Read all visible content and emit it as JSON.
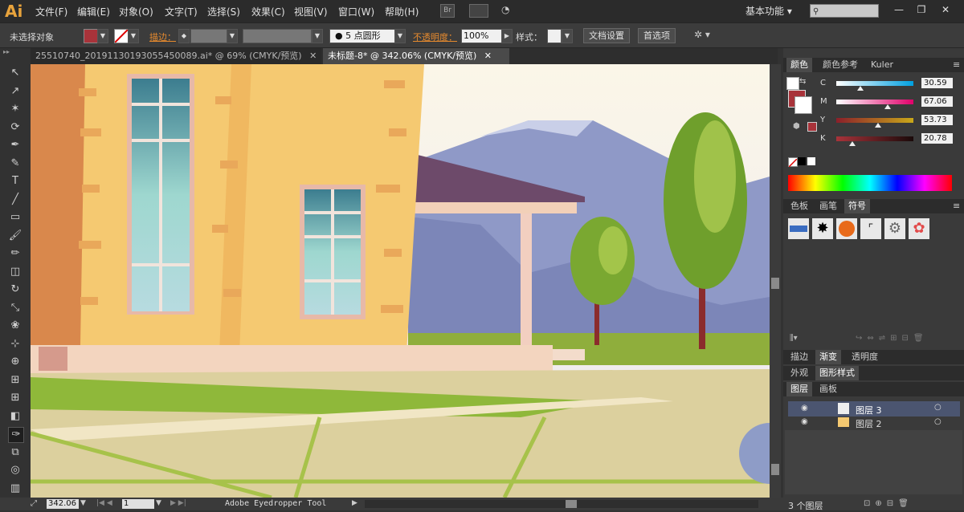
{
  "app": {
    "logo": "Ai"
  },
  "menu": [
    "文件(F)",
    "编辑(E)",
    "对象(O)",
    "文字(T)",
    "选择(S)",
    "效果(C)",
    "视图(V)",
    "窗口(W)",
    "帮助(H)"
  ],
  "toolbar_icons": {
    "bridge": "Br"
  },
  "workspace": {
    "label": "基本功能"
  },
  "window_controls": {
    "minimize": "—",
    "restore": "❐",
    "close": "✕"
  },
  "control_bar": {
    "selection": "未选择对象",
    "fill_color": "#a8333a",
    "stroke_label": "描边：",
    "brush": "5 点圆形",
    "opacity_label": "不透明度：",
    "opacity_value": "100%",
    "style_label": "样式：",
    "doc_settings": "文档设置",
    "preferences": "首选项"
  },
  "tabs": [
    {
      "title": "25510740_2019113019305545008​9.ai* @ 69% (CMYK/预览)",
      "close": "✕"
    },
    {
      "title": "未标题-8* @ 342.06% (CMYK/预览)",
      "close": "✕"
    }
  ],
  "tools": [
    "selection-tool",
    "direct-selection-tool",
    "magic-wand-tool",
    "lasso-tool",
    "pen-tool",
    "curvature-tool",
    "type-tool",
    "line-tool",
    "rectangle-tool",
    "paintbrush-tool",
    "pencil-tool",
    "eraser-tool",
    "rotate-tool",
    "scale-tool",
    "warp-tool",
    "free-transform-tool",
    "shape-builder-tool",
    "perspective-grid-tool",
    "mesh-tool",
    "gradient-tool",
    "eyedropper-tool",
    "blend-tool",
    "symbol-sprayer-tool",
    "column-graph-tool"
  ],
  "color_panel": {
    "tabs": [
      "颜色",
      "颜色参考",
      "Kuler"
    ],
    "channels": [
      {
        "label": "C",
        "value": "30.59",
        "fraction": 0.31
      },
      {
        "label": "M",
        "value": "67.06",
        "fraction": 0.67
      },
      {
        "label": "Y",
        "value": "53.73",
        "fraction": 0.54
      },
      {
        "label": "K",
        "value": "20.78",
        "fraction": 0.21
      }
    ],
    "current_color": "#a8333a"
  },
  "symbols_panel": {
    "tabs": [
      "色板",
      "画笔",
      "符号"
    ]
  },
  "stroke_panel": {
    "tabs": [
      "描边",
      "渐变",
      "透明度"
    ]
  },
  "appearance_panel": {
    "tabs": [
      "外观",
      "图形样式"
    ]
  },
  "layers_panel": {
    "tabs": [
      "图层",
      "画板"
    ],
    "layers": [
      {
        "name": "图层 3"
      },
      {
        "name": "图层 2"
      }
    ],
    "count": "3 个图层"
  },
  "status": {
    "zoom": "342.06",
    "artboard": "1",
    "tool": "Adobe Eyedropper Tool"
  }
}
